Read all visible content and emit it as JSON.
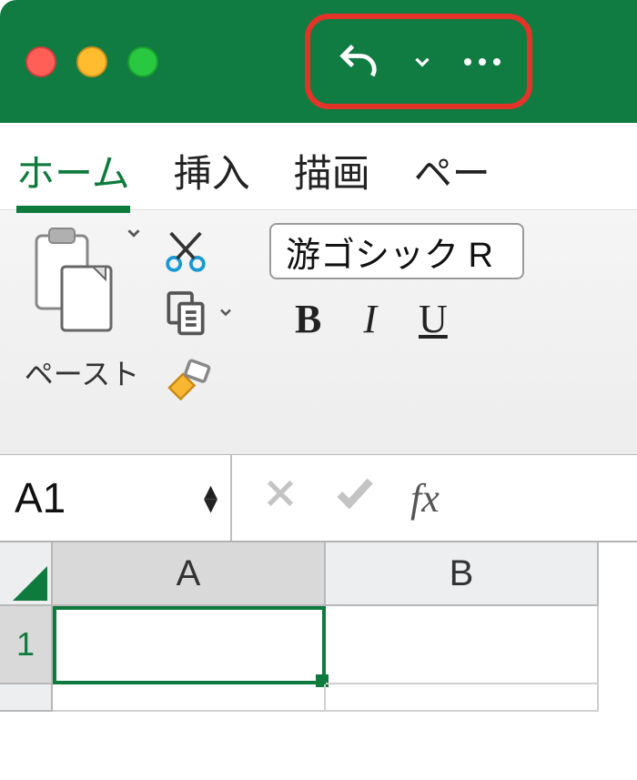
{
  "titlebar": {
    "traffic": {
      "close": "close",
      "minimize": "minimize",
      "maximize": "maximize"
    }
  },
  "qat": {
    "undo": "undo",
    "history_dropdown": "v",
    "more": "more"
  },
  "tabs": {
    "items": [
      {
        "label": "ホーム",
        "active": true
      },
      {
        "label": "挿入",
        "active": false
      },
      {
        "label": "描画",
        "active": false
      },
      {
        "label": "ペー",
        "active": false
      }
    ]
  },
  "ribbon": {
    "paste_label": "ペースト",
    "font_name": "游ゴシック R",
    "bold": "B",
    "italic": "I",
    "underline": "U"
  },
  "formula_bar": {
    "name_box": "A1",
    "cancel": "×",
    "confirm": "✓",
    "fx": "fx"
  },
  "grid": {
    "columns": [
      "A",
      "B"
    ],
    "rows": [
      "1"
    ],
    "selected_cell": "A1"
  },
  "colors": {
    "brand": "#107c41",
    "highlight": "#e4342a"
  }
}
